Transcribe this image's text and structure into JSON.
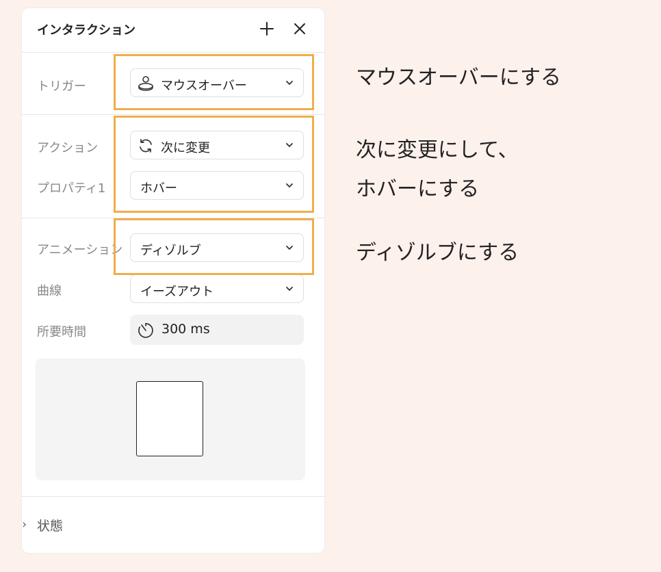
{
  "panel": {
    "title": "インタラクション",
    "add_icon": "plus-icon",
    "close_icon": "close-icon"
  },
  "trigger": {
    "label": "トリガー",
    "value": "マウスオーバー",
    "icon": "mouse-hover-icon"
  },
  "action": {
    "label": "アクション",
    "value": "次に変更",
    "icon": "refresh-icon"
  },
  "property": {
    "label": "プロパティ1",
    "value": "ホバー"
  },
  "animation": {
    "label": "アニメーション",
    "value": "ディゾルブ"
  },
  "curve": {
    "label": "曲線",
    "value": "イーズアウト"
  },
  "duration": {
    "label": "所要時間",
    "value": "300 ms",
    "icon": "timer-icon"
  },
  "state_section": {
    "label": "状態",
    "chevron": "›"
  },
  "annotations": {
    "trigger_note": "マウスオーバーにする",
    "action_note_line1": "次に変更にして、",
    "action_note_line2": "ホバーにする",
    "animation_note": "ディゾルブにする"
  },
  "colors": {
    "background": "#fdf1ec",
    "highlight": "#f0ad4e",
    "panel": "#ffffff"
  }
}
